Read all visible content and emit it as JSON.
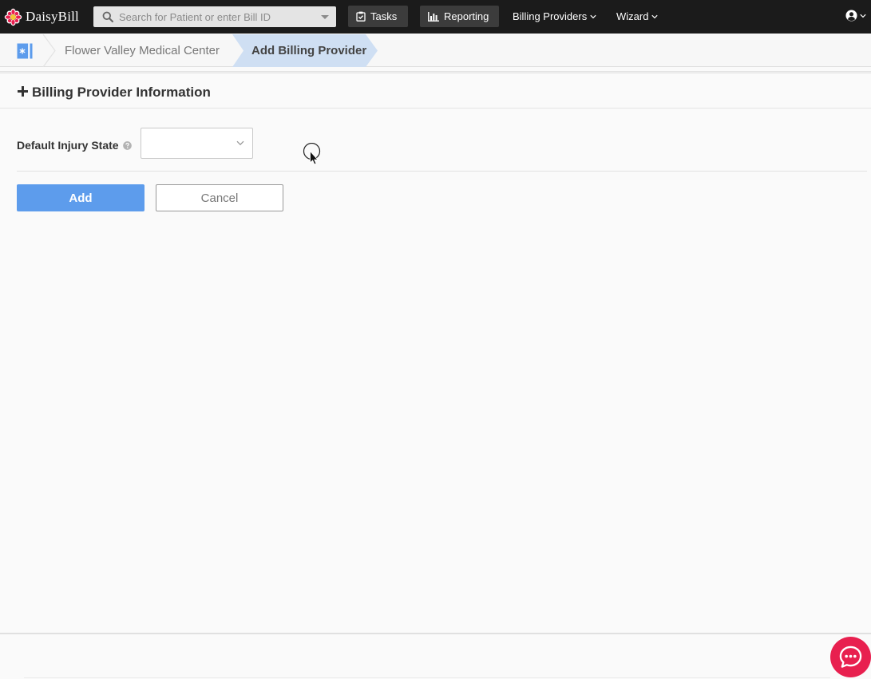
{
  "app": {
    "name": "DaisyBill"
  },
  "topbar": {
    "search_placeholder": "Search for Patient or enter Bill ID",
    "tasks_label": "Tasks",
    "reporting_label": "Reporting",
    "billing_providers_label": "Billing Providers",
    "wizard_label": "Wizard"
  },
  "breadcrumb": {
    "items": [
      {
        "label": "Flower Valley Medical Center"
      },
      {
        "label": "Add Billing Provider"
      }
    ]
  },
  "section": {
    "title": "Billing Provider Information"
  },
  "form": {
    "default_injury_state_label": "Default Injury State",
    "default_injury_state_value": ""
  },
  "actions": {
    "add_label": "Add",
    "cancel_label": "Cancel"
  },
  "colors": {
    "topbar_bg": "#1b1b1b",
    "primary_button": "#5d9cec",
    "breadcrumb_active": "#cfdff3",
    "chat_bubble": "#e8204f"
  },
  "icons": [
    "daisy-logo-icon",
    "search-icon",
    "caret-down-icon",
    "clipboard-check-icon",
    "bar-chart-icon",
    "chevron-down-icon",
    "user-circle-icon",
    "medical-card-icon",
    "plus-icon",
    "help-circle-icon",
    "chat-icon",
    "mouse-cursor-icon"
  ]
}
